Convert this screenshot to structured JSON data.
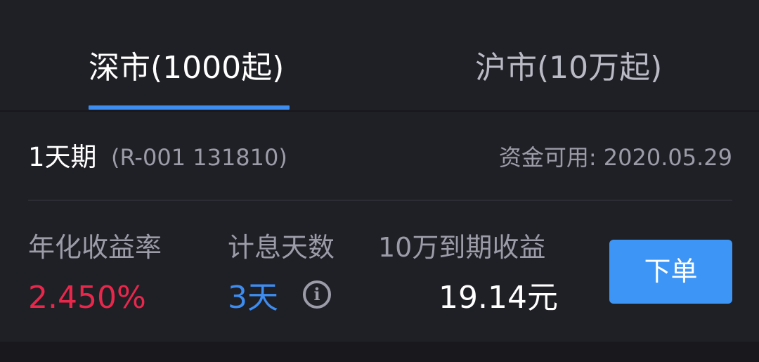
{
  "tabs": [
    {
      "label": "深市(1000起)",
      "active": true
    },
    {
      "label": "沪市(10万起)",
      "active": false
    }
  ],
  "product": {
    "name": "1天期",
    "code": "(R-001 131810)",
    "funds_available": "资金可用: 2020.05.29"
  },
  "info": {
    "rate_label": "年化收益率",
    "rate_value": "2.450%",
    "days_label": "计息天数",
    "days_value": "3天",
    "info_icon_glyph": "i",
    "profit_label": "10万到期收益",
    "profit_value": "19.14元"
  },
  "actions": {
    "order_label": "下单"
  },
  "colors": {
    "background": "#1f1f26",
    "accent_blue": "#3d8cf0",
    "rate_red": "#e8274b",
    "button_blue": "#3d95f5",
    "muted_text": "#9c9ca8"
  }
}
